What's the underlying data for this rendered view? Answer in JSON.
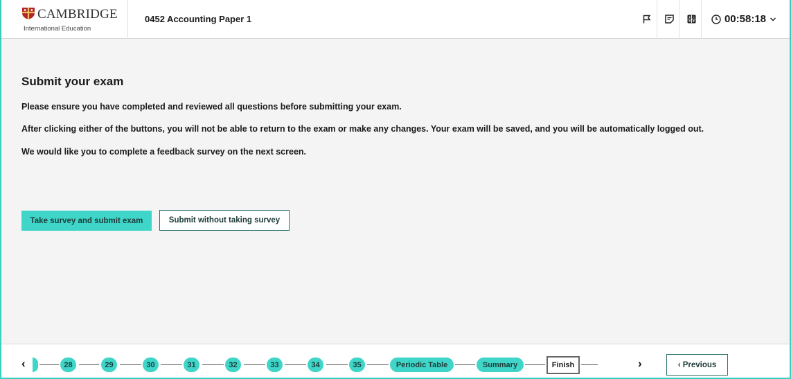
{
  "header": {
    "logo_word": "CAMBRIDGE",
    "logo_sub": "International Education",
    "paper_title": "0452 Accounting Paper 1",
    "timer": "00:58:18",
    "icons": [
      "flag-icon",
      "notes-icon",
      "calculator-icon",
      "clock-icon",
      "chevron-down-icon"
    ]
  },
  "main": {
    "title": "Submit your exam",
    "line1": "Please ensure you have completed and reviewed all questions before submitting your exam.",
    "line2": "After clicking either of the buttons, you will not be able to return to the exam or make any changes. Your exam will be saved, and you will be automatically logged out.",
    "line3": "We would like you to complete a feedback survey on the next screen.",
    "btn_survey": "Take survey and submit exam",
    "btn_no_survey": "Submit without taking survey"
  },
  "footer": {
    "left_arrow": "‹",
    "right_arrow": "›",
    "questions": [
      "28",
      "29",
      "30",
      "31",
      "32",
      "33",
      "34",
      "35"
    ],
    "periodic": "Periodic Table",
    "summary": "Summary",
    "finish": "Finish",
    "previous": "‹ Previous"
  },
  "colors": {
    "accent": "#3fd5c8",
    "border_accent": "#3bcfc0",
    "dark_teal": "#2a6f68",
    "main_bg": "#f4f4f4",
    "shield_red": "#b3262d"
  }
}
